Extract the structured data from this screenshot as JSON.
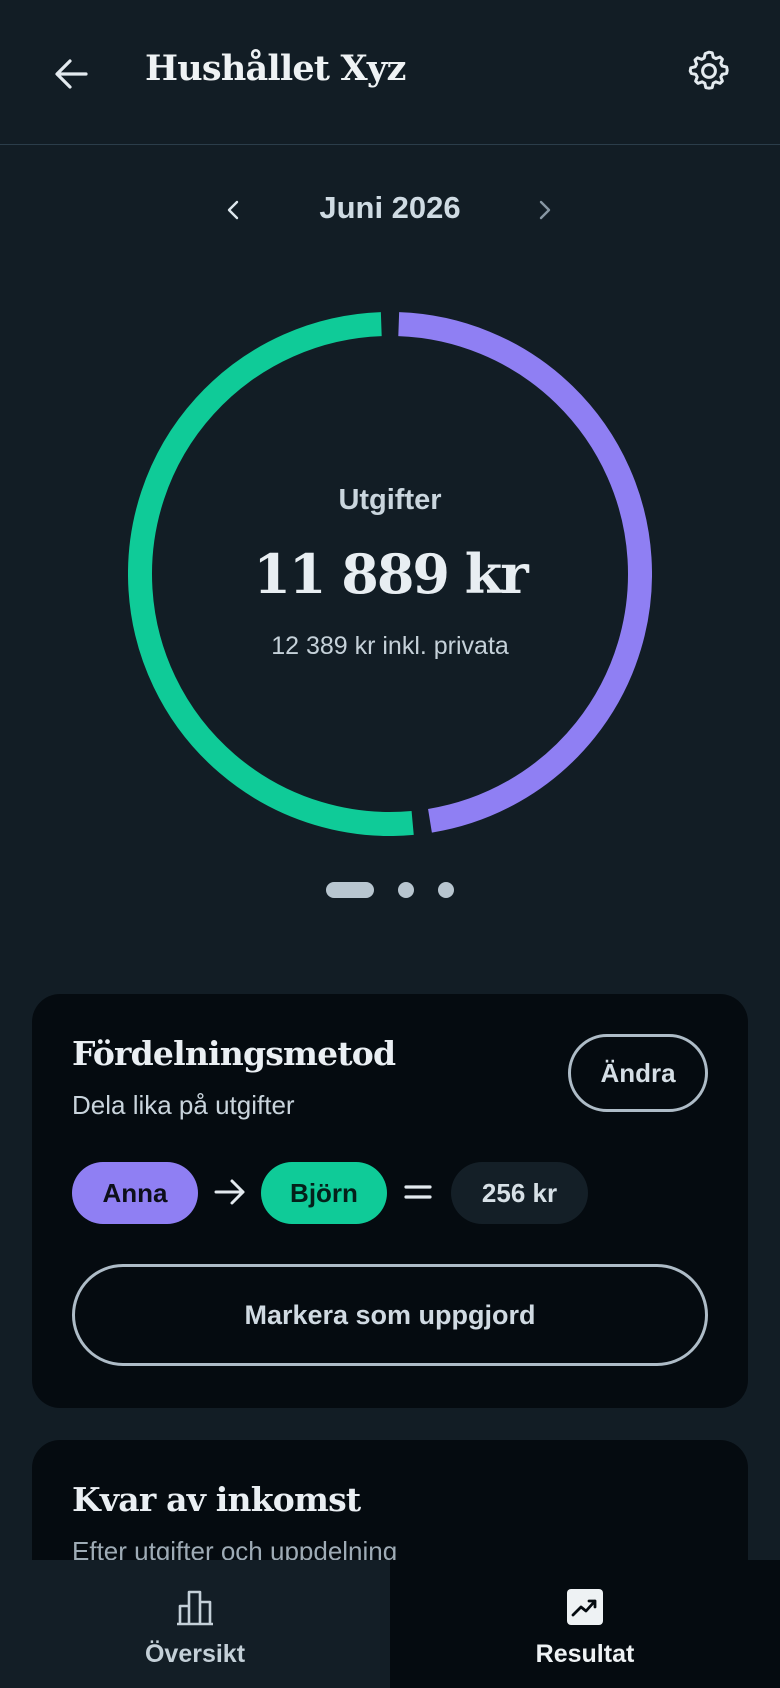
{
  "header": {
    "title": "Hushållet Xyz",
    "back_icon": "arrow-left-icon",
    "settings_icon": "gear-icon"
  },
  "month": {
    "label": "Juni 2026",
    "prev_icon": "chevron-left-icon",
    "next_icon": "chevron-right-icon"
  },
  "summary": {
    "label": "Utgifter",
    "amount": "11 889 kr",
    "subtext": "12 389 kr inkl. privata",
    "chart": {
      "type": "pie",
      "segments": [
        {
          "color": "#0fcb98",
          "fraction": 0.52
        },
        {
          "color": "#8f7ff3",
          "fraction": 0.48
        }
      ]
    }
  },
  "pager": {
    "count": 3,
    "active": 0
  },
  "split_card": {
    "title": "Fördelningsmetod",
    "subtitle": "Dela lika på utgifter",
    "change_label": "Ändra",
    "from_person": "Anna",
    "to_person": "Björn",
    "amount": "256 kr",
    "arrow_icon": "arrow-right-icon",
    "equals_icon": "equals-icon",
    "settle_label": "Markera som uppgjord",
    "colors": {
      "from": "#8f7ff3",
      "to": "#0fcb98"
    }
  },
  "income_card": {
    "title": "Kvar av inkomst",
    "subtitle": "Efter utgifter och uppdelning"
  },
  "bottom_nav": {
    "tabs": [
      {
        "label": "Översikt",
        "icon": "bar-chart-icon",
        "active": false
      },
      {
        "label": "Resultat",
        "icon": "trending-up-icon",
        "active": true
      }
    ]
  }
}
